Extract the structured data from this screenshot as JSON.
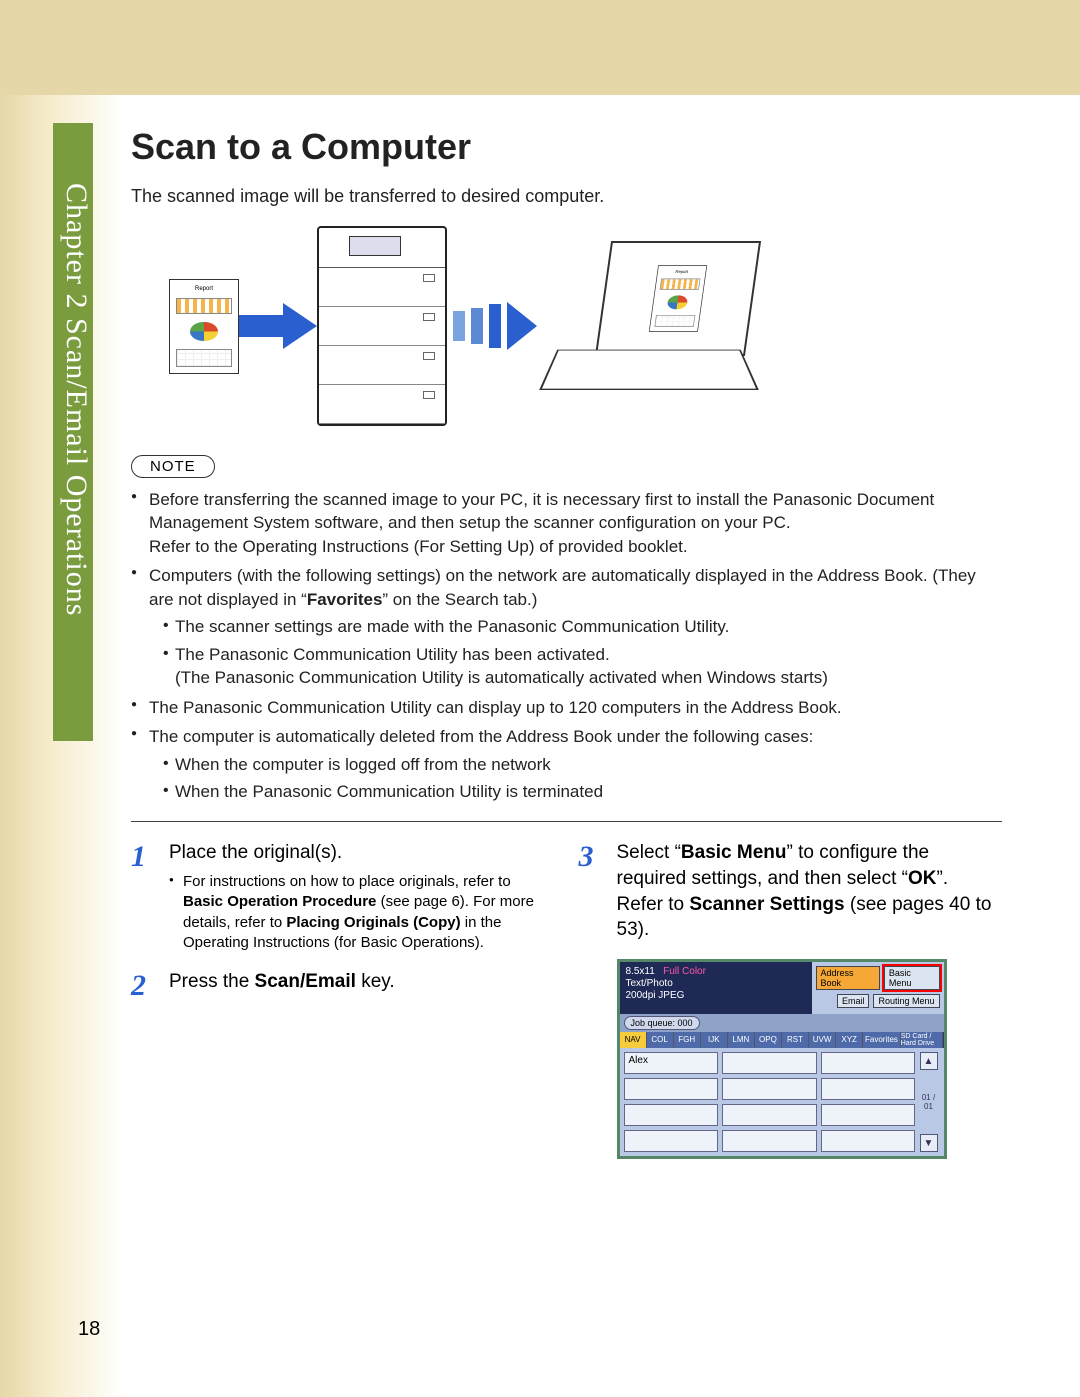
{
  "tab_label": "Chapter 2   Scan/Email Operations",
  "title": "Scan to a Computer",
  "intro": "The scanned image will be transferred to desired computer.",
  "report_label": "Report",
  "note_label": "NOTE",
  "notes": {
    "n1": "Before transferring the scanned image to your PC, it is necessary first to install the Panasonic Document Management System software, and then setup the scanner configuration on your PC.",
    "n1b": "Refer to the Operating Instructions (For Setting Up) of provided booklet.",
    "n2a": "Computers (with the following settings) on the network are automatically displayed in the Address Book. (They are not displayed in “",
    "n2bold": "Favorites",
    "n2b": "” on the Search tab.)",
    "n2s1": "The scanner settings are made with the Panasonic Communication Utility.",
    "n2s2": "The Panasonic Communication Utility has been activated.",
    "n2s2b": "(The Panasonic Communication Utility is automatically activated when Windows starts)",
    "n3": "The Panasonic Communication Utility can display up to 120 computers in the Address Book.",
    "n4": "The computer is automatically deleted from the Address Book under the following cases:",
    "n4s1": "When the computer is logged off from the network",
    "n4s2": "When the Panasonic Communication Utility is terminated"
  },
  "steps": {
    "s1": {
      "num": "1",
      "text": "Place the original(s).",
      "b1a": "For instructions on how to place originals, refer to ",
      "b1bold1": "Basic Operation Procedure",
      "b1b": " (see page 6). For more details, refer to ",
      "b1bold2": "Placing Originals (Copy)",
      "b1c": " in the Operating Instructions (for Basic Operations)."
    },
    "s2": {
      "num": "2",
      "pre": "Press the ",
      "bold": "Scan/Email",
      "post": " key."
    },
    "s3": {
      "num": "3",
      "t1a": "Select “",
      "t1bold": "Basic Menu",
      "t1b": "” to configure the required settings, and then select “",
      "t1ok": "OK",
      "t1c": "”.",
      "t2a": "Refer to ",
      "t2bold": "Scanner Settings",
      "t2b": " (see pages 40 to 53)."
    }
  },
  "screenshot": {
    "info1": "8.5x11",
    "info2": "Full Color",
    "info3": "Text/Photo",
    "info4": "200dpi JPEG",
    "addr": "Address Book",
    "basic": "Basic Menu",
    "job": "Job queue: 000",
    "email": "Email",
    "routing": "Routing Menu",
    "tabs": [
      "NAV",
      "COL",
      "FGH",
      "IJK",
      "LMN",
      "OPQ",
      "RST",
      "UVW",
      "XYZ",
      "Favorites",
      "SD Card / Hard Drive"
    ],
    "cell": "Alex",
    "page": "01 / 01"
  },
  "page_number": "18"
}
